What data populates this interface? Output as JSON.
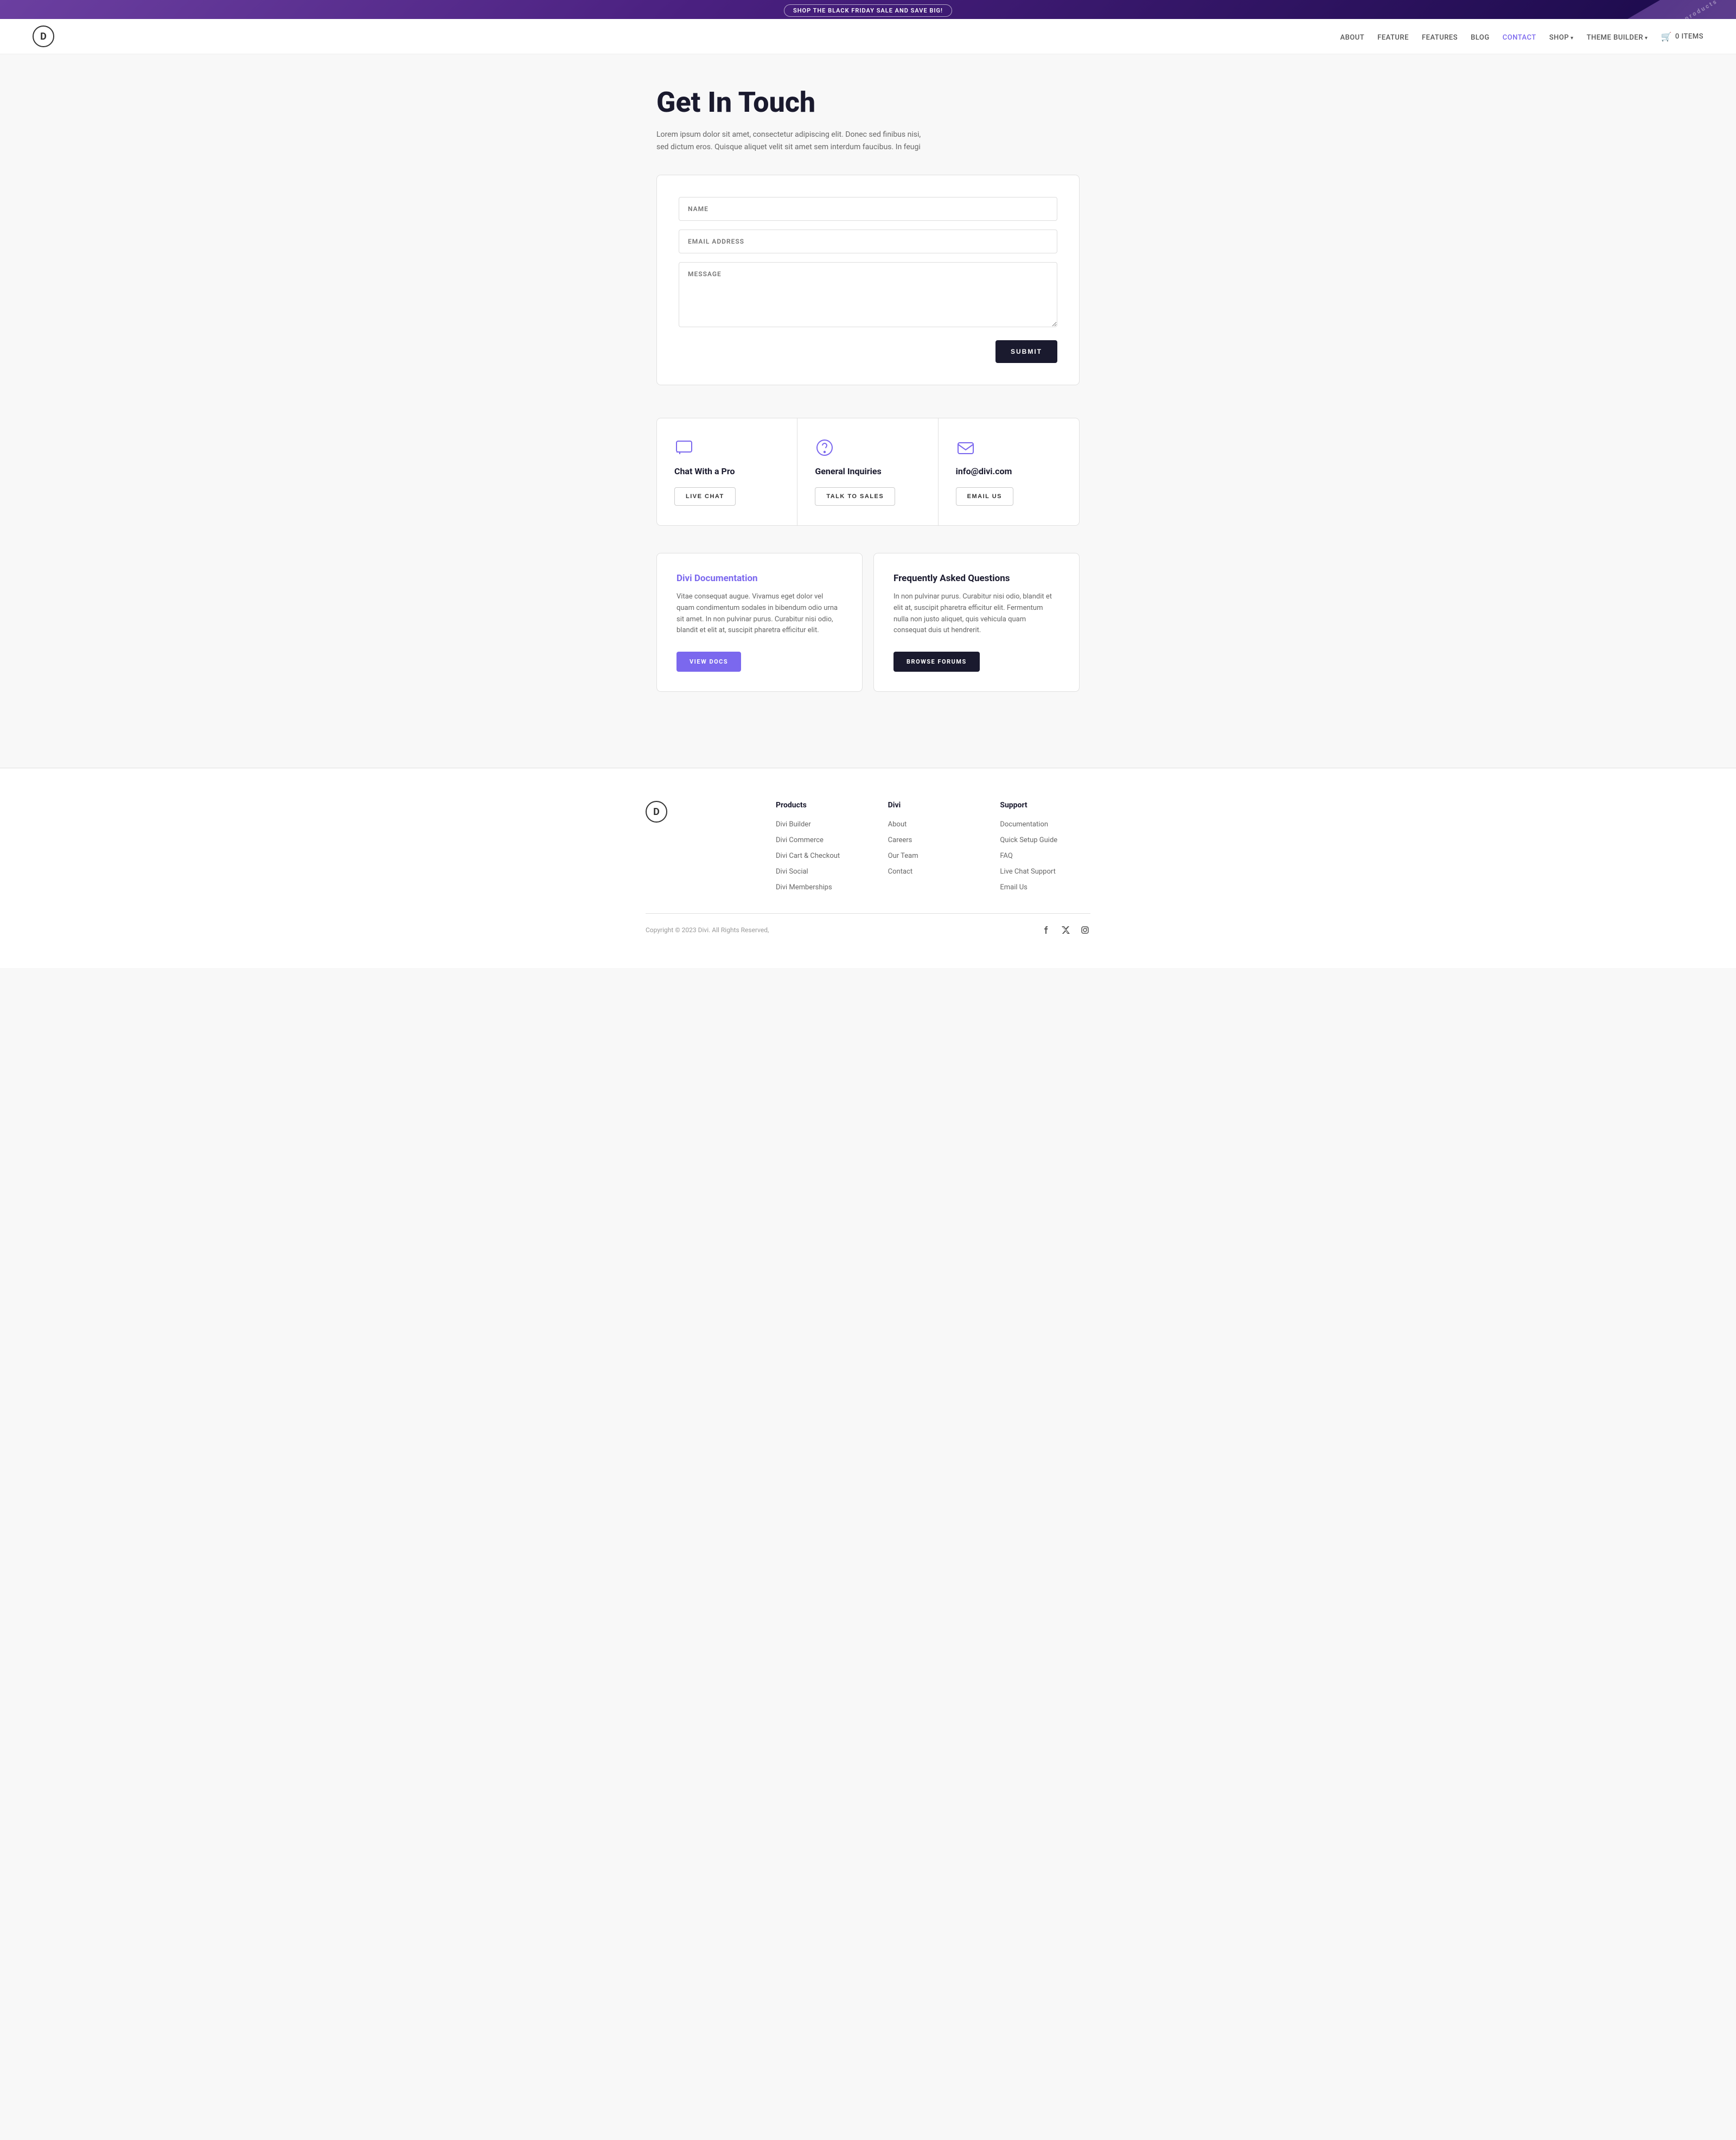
{
  "banner": {
    "label": "SHOP THE BLACK FRIDAY SALE AND SAVE BIG!",
    "bg_text": "products"
  },
  "nav": {
    "logo_letter": "D",
    "links": [
      {
        "label": "ABOUT",
        "href": "#",
        "active": false
      },
      {
        "label": "FEATURE",
        "href": "#",
        "active": false
      },
      {
        "label": "FEATURES",
        "href": "#",
        "active": false
      },
      {
        "label": "BLOG",
        "href": "#",
        "active": false
      },
      {
        "label": "CONTACT",
        "href": "#",
        "active": true
      },
      {
        "label": "SHOP",
        "href": "#",
        "active": false,
        "has_arrow": true
      },
      {
        "label": "THEME BUILDER",
        "href": "#",
        "active": false,
        "has_arrow": true
      }
    ],
    "cart_label": "0 ITEMS"
  },
  "hero": {
    "title": "Get In Touch",
    "subtitle": "Lorem ipsum dolor sit amet, consectetur adipiscing elit. Donec sed finibus nisi, sed dictum eros. Quisque aliquet velit sit amet sem interdum faucibus. In feugi"
  },
  "form": {
    "name_placeholder": "NAME",
    "email_placeholder": "EMAIL ADDRESS",
    "message_placeholder": "MESSAGE",
    "submit_label": "SUBMIT"
  },
  "contact_cards": [
    {
      "icon": "chat",
      "title": "Chat With a Pro",
      "btn_label": "LIVE CHAT"
    },
    {
      "icon": "question",
      "title": "General Inquiries",
      "btn_label": "TALK TO SALES"
    },
    {
      "icon": "email",
      "title": "info@divi.com",
      "btn_label": "EMAIL US"
    }
  ],
  "resources": [
    {
      "type": "purple",
      "title": "Divi Documentation",
      "body": "Vitae consequat augue. Vivamus eget dolor vel quam condimentum sodales in bibendum odio urna sit amet. In non pulvinar purus. Curabitur nisi odio, blandit et elit at, suscipit pharetra efficitur elit.",
      "btn_label": "VIEW DOCS"
    },
    {
      "type": "dark",
      "title": "Frequently Asked Questions",
      "body": "In non pulvinar purus. Curabitur nisi odio, blandit et elit at, suscipit pharetra efficitur elit. Fermentum nulla non justo aliquet, quis vehicula quam consequat duis ut hendrerit.",
      "btn_label": "BROWSE FORUMS"
    }
  ],
  "footer": {
    "logo_letter": "D",
    "columns": [
      {
        "heading": "Products",
        "links": [
          "Divi Builder",
          "Divi Commerce",
          "Divi Cart & Checkout",
          "Divi Social",
          "Divi Memberships"
        ]
      },
      {
        "heading": "Divi",
        "links": [
          "About",
          "Careers",
          "Our Team",
          "Contact"
        ]
      },
      {
        "heading": "Support",
        "links": [
          "Documentation",
          "Quick Setup Guide",
          "FAQ",
          "Live Chat Support",
          "Email Us"
        ]
      }
    ],
    "copyright": "Copyright © 2023 Divi. All Rights Reserved,",
    "social": [
      {
        "name": "facebook",
        "symbol": "f"
      },
      {
        "name": "twitter-x",
        "symbol": "𝕏"
      },
      {
        "name": "instagram",
        "symbol": "◎"
      }
    ]
  }
}
